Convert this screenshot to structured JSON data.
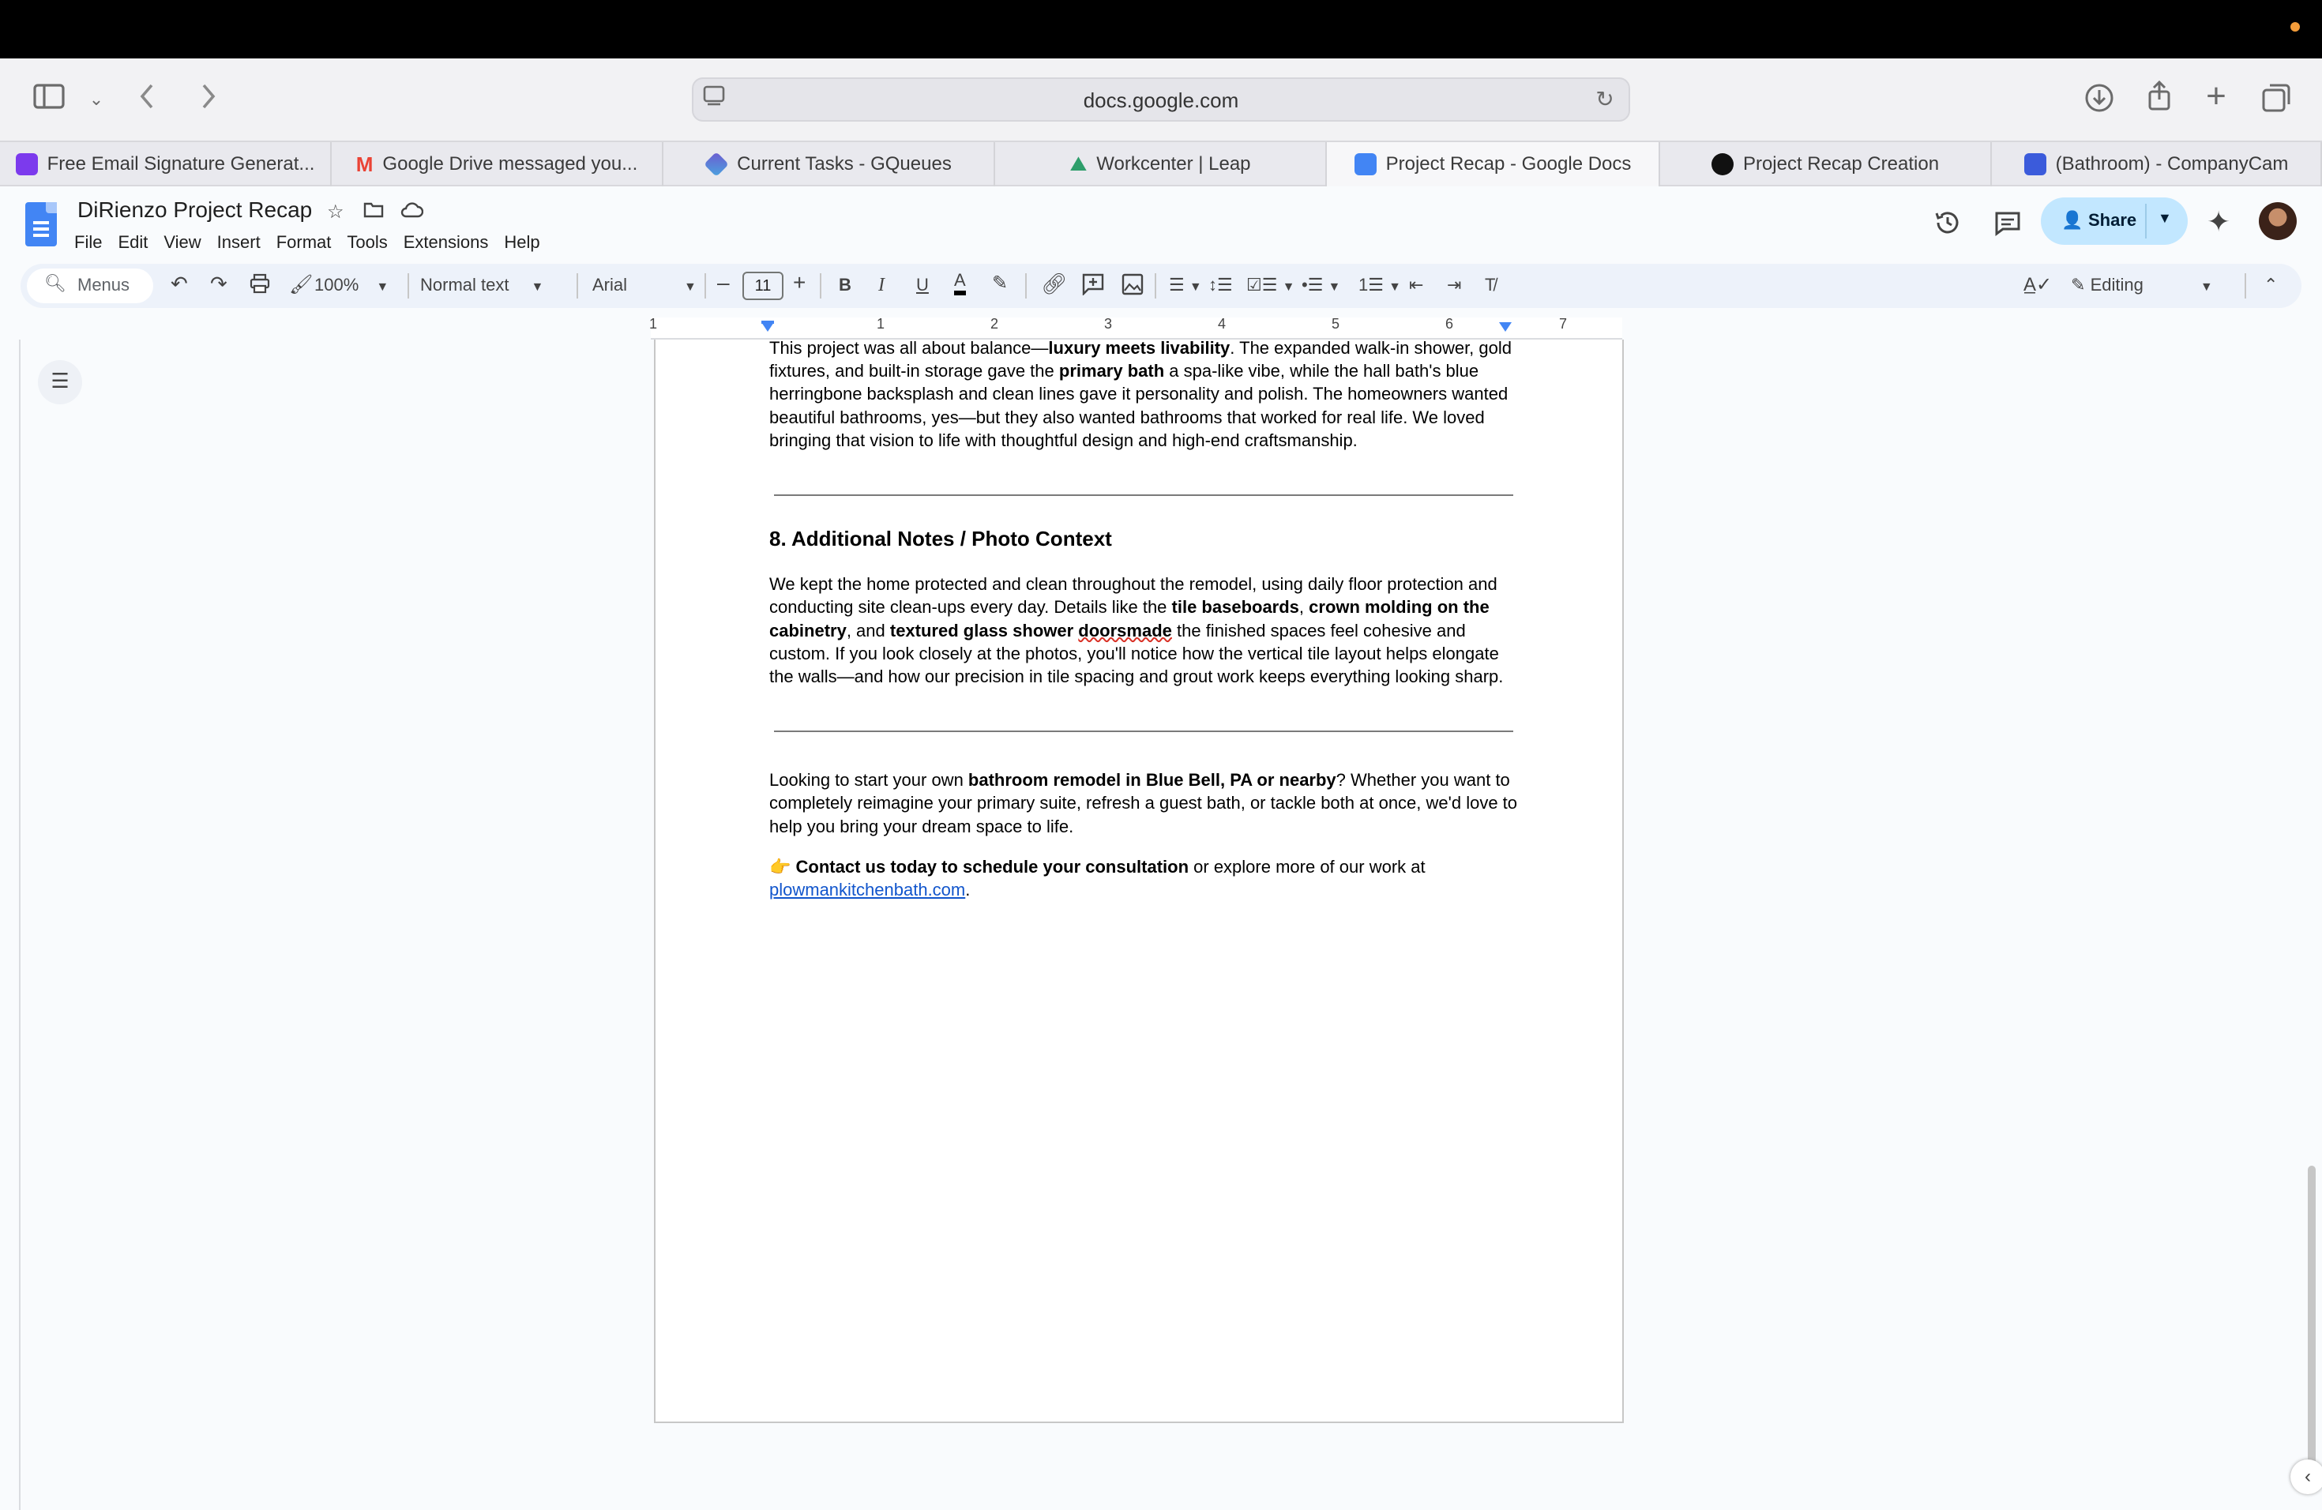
{
  "browser": {
    "url": "docs.google.com",
    "tabs": [
      {
        "label": "Free Email Signature Generat...",
        "icon": "signature-icon",
        "color": "#7c3aed"
      },
      {
        "label": "Google Drive messaged you...",
        "icon": "gmail-icon",
        "color": "#ea4335"
      },
      {
        "label": "Current Tasks - GQueues",
        "icon": "gqueues-icon",
        "color": "#6d5bd0"
      },
      {
        "label": "Workcenter | Leap",
        "icon": "leap-icon",
        "color": "#2e9e6b"
      },
      {
        "label": "Project Recap - Google Docs",
        "icon": "docs-icon",
        "color": "#4285f4"
      },
      {
        "label": "Project Recap Creation",
        "icon": "chatgpt-icon",
        "color": "#111111"
      },
      {
        "label": "(Bathroom) - CompanyCam",
        "icon": "companycam-icon",
        "color": "#3b5bdb"
      }
    ]
  },
  "docs": {
    "title": "DiRienzo Project Recap",
    "menu": [
      "File",
      "Edit",
      "View",
      "Insert",
      "Format",
      "Tools",
      "Extensions",
      "Help"
    ],
    "share_label": "Share",
    "toolbar": {
      "menus_placeholder": "Menus",
      "zoom": "100%",
      "style": "Normal text",
      "font": "Arial",
      "font_size": "11",
      "mode": "Editing"
    },
    "ruler_numbers": [
      "1",
      "1",
      "2",
      "3",
      "4",
      "5",
      "6",
      "7"
    ]
  },
  "document": {
    "p1": {
      "a": "This project was all about balance—",
      "b": "luxury meets livability",
      "c": ". The expanded walk-in shower, gold fixtures, and built-in storage gave the ",
      "d": "primary bath",
      "e": " a spa-like vibe, while the hall bath's blue herringbone backsplash and clean lines gave it personality and polish. The homeowners wanted beautiful bathrooms, yes—but they also wanted bathrooms that worked for real life. We loved bringing that vision to life with thoughtful design and high-end craftsmanship."
    },
    "heading": "8. Additional Notes / Photo Context",
    "p2": {
      "a": "We kept the home protected and clean throughout the remodel, using daily floor protection and conducting site clean-ups every day. Details like the ",
      "b": "tile baseboards",
      "c": ", ",
      "d": "crown molding on the cabinetry",
      "e": ", and ",
      "f": "textured glass shower ",
      "g": "doorsmade",
      "h": " the finished spaces feel cohesive and custom. If you look closely at the photos, you'll notice how the vertical tile layout helps elongate the walls—and how our precision in tile spacing and grout work keeps everything looking sharp."
    },
    "p3": {
      "a": "Looking to start your own ",
      "b": "bathroom remodel in Blue Bell, PA or nearby",
      "c": "? Whether you want to completely reimagine your primary suite, refresh a guest bath, or tackle both at once, we'd love to help you bring your dream space to life."
    },
    "p4": {
      "emoji": "👉",
      "a": "Contact us today to schedule your consultation",
      "b": " or explore more of our work at ",
      "link": "plowmankitchenbath.com",
      "end": "."
    }
  }
}
